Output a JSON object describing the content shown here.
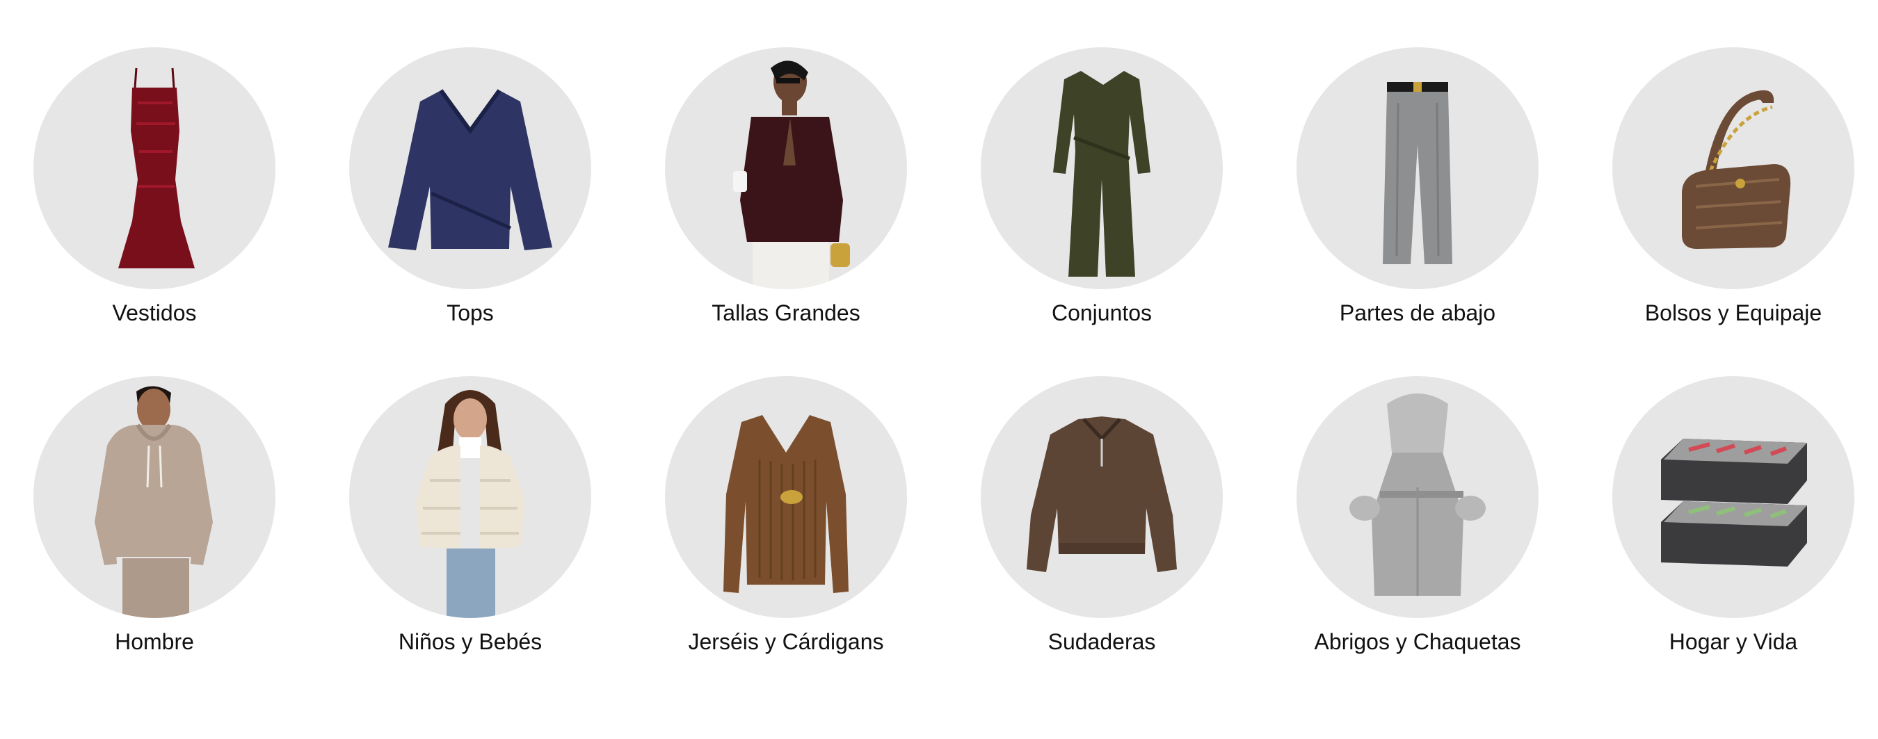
{
  "categories": [
    {
      "label": "Vestidos",
      "icon": "dress-icon",
      "color": "#7a0f1c"
    },
    {
      "label": "Tops",
      "icon": "wrap-top-icon",
      "color": "#2e3564"
    },
    {
      "label": "Tallas Grandes",
      "icon": "blazer-model-icon",
      "color": "#3a1418"
    },
    {
      "label": "Conjuntos",
      "icon": "jumpsuit-icon",
      "color": "#3e4227"
    },
    {
      "label": "Partes de abajo",
      "icon": "trousers-icon",
      "color": "#8e8f90"
    },
    {
      "label": "Bolsos y Equipaje",
      "icon": "handbag-icon",
      "color": "#6b4a36"
    },
    {
      "label": "Hombre",
      "icon": "hoodie-model-icon",
      "color": "#b8a596"
    },
    {
      "label": "Niños y Bebés",
      "icon": "puffer-jacket-child-icon",
      "color": "#ede5d6"
    },
    {
      "label": "Jerséis y Cárdigans",
      "icon": "knit-sweater-icon",
      "color": "#7b4f2e"
    },
    {
      "label": "Sudaderas",
      "icon": "sweatshirt-icon",
      "color": "#5d4535"
    },
    {
      "label": "Abrigos y Chaquetas",
      "icon": "fur-coat-icon",
      "color": "#a8a8a8"
    },
    {
      "label": "Hogar y Vida",
      "icon": "storage-organizer-icon",
      "color": "#3b3b3e"
    }
  ]
}
